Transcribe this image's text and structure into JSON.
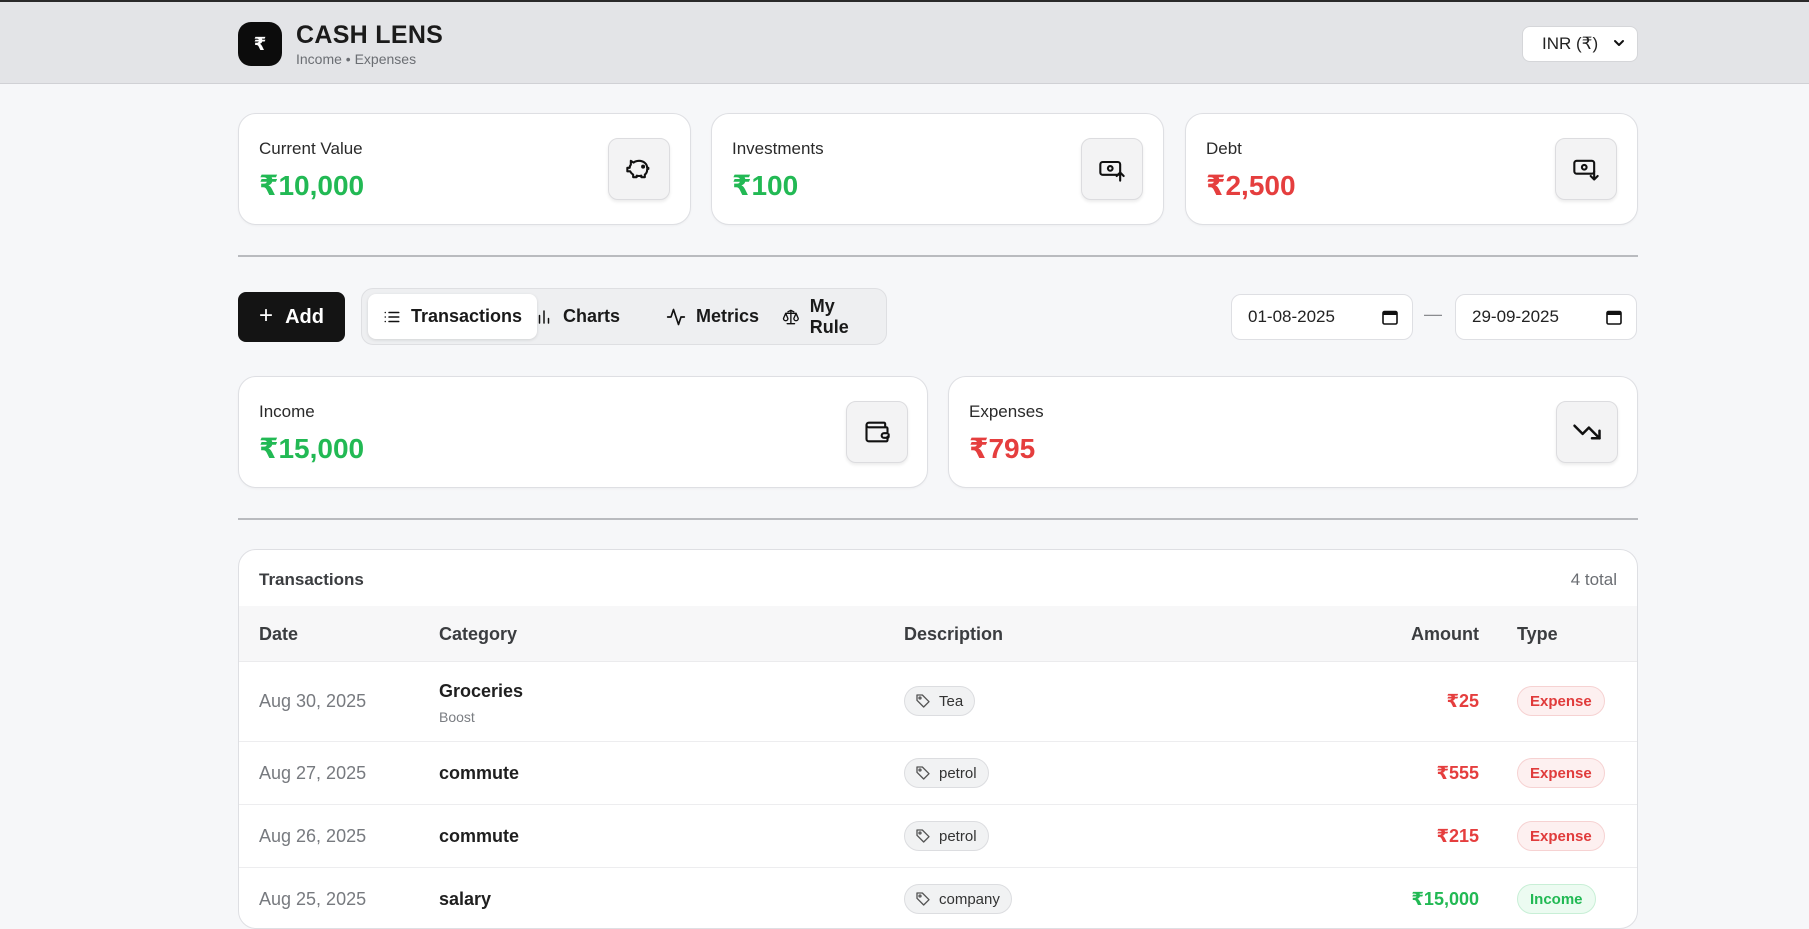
{
  "header": {
    "logo_glyph": "₹",
    "title": "CASH LENS",
    "subtitle": "Income • Expenses",
    "currency_value": "INR (₹)"
  },
  "summary_cards": [
    {
      "label": "Current Value",
      "value": "₹10,000",
      "color": "#22b954",
      "icon": "piggy-bank-icon"
    },
    {
      "label": "Investments",
      "value": "₹100",
      "color": "#22b954",
      "icon": "banknote-arrow-up-icon"
    },
    {
      "label": "Debt",
      "value": "₹2,500",
      "color": "#e53e3e",
      "icon": "banknote-arrow-down-icon"
    }
  ],
  "toolbar": {
    "add_label": "Add",
    "tabs": [
      {
        "label": "Transactions",
        "icon": "list-icon",
        "active": true
      },
      {
        "label": "Charts",
        "icon": "bar-chart-icon",
        "active": false
      },
      {
        "label": "Metrics",
        "icon": "activity-icon",
        "active": false
      },
      {
        "label": "My Rule",
        "icon": "scale-icon",
        "active": false
      }
    ],
    "date_from": "01-08-2025",
    "date_separator": "—",
    "date_to": "29-09-2025"
  },
  "period_cards": [
    {
      "label": "Income",
      "value": "₹15,000",
      "color": "#22b954",
      "icon": "wallet-icon"
    },
    {
      "label": "Expenses",
      "value": "₹795",
      "color": "#e53e3e",
      "icon": "trending-down-icon"
    }
  ],
  "transactions": {
    "title": "Transactions",
    "total": "4 total",
    "columns": [
      "Date",
      "Category",
      "Description",
      "Amount",
      "Type"
    ],
    "rows": [
      {
        "date": "Aug 30, 2025",
        "category": "Groceries",
        "subcategory": "Boost",
        "description": "Tea",
        "amount": "₹25",
        "type": "Expense"
      },
      {
        "date": "Aug 27, 2025",
        "category": "commute",
        "subcategory": "",
        "description": "petrol",
        "amount": "₹555",
        "type": "Expense"
      },
      {
        "date": "Aug 26, 2025",
        "category": "commute",
        "subcategory": "",
        "description": "petrol",
        "amount": "₹215",
        "type": "Expense"
      },
      {
        "date": "Aug 25, 2025",
        "category": "salary",
        "subcategory": "",
        "description": "company",
        "amount": "₹15,000",
        "type": "Income"
      }
    ]
  },
  "colors": {
    "income": "#22b954",
    "expense": "#e53e3e",
    "accent_dark": "#141414"
  }
}
